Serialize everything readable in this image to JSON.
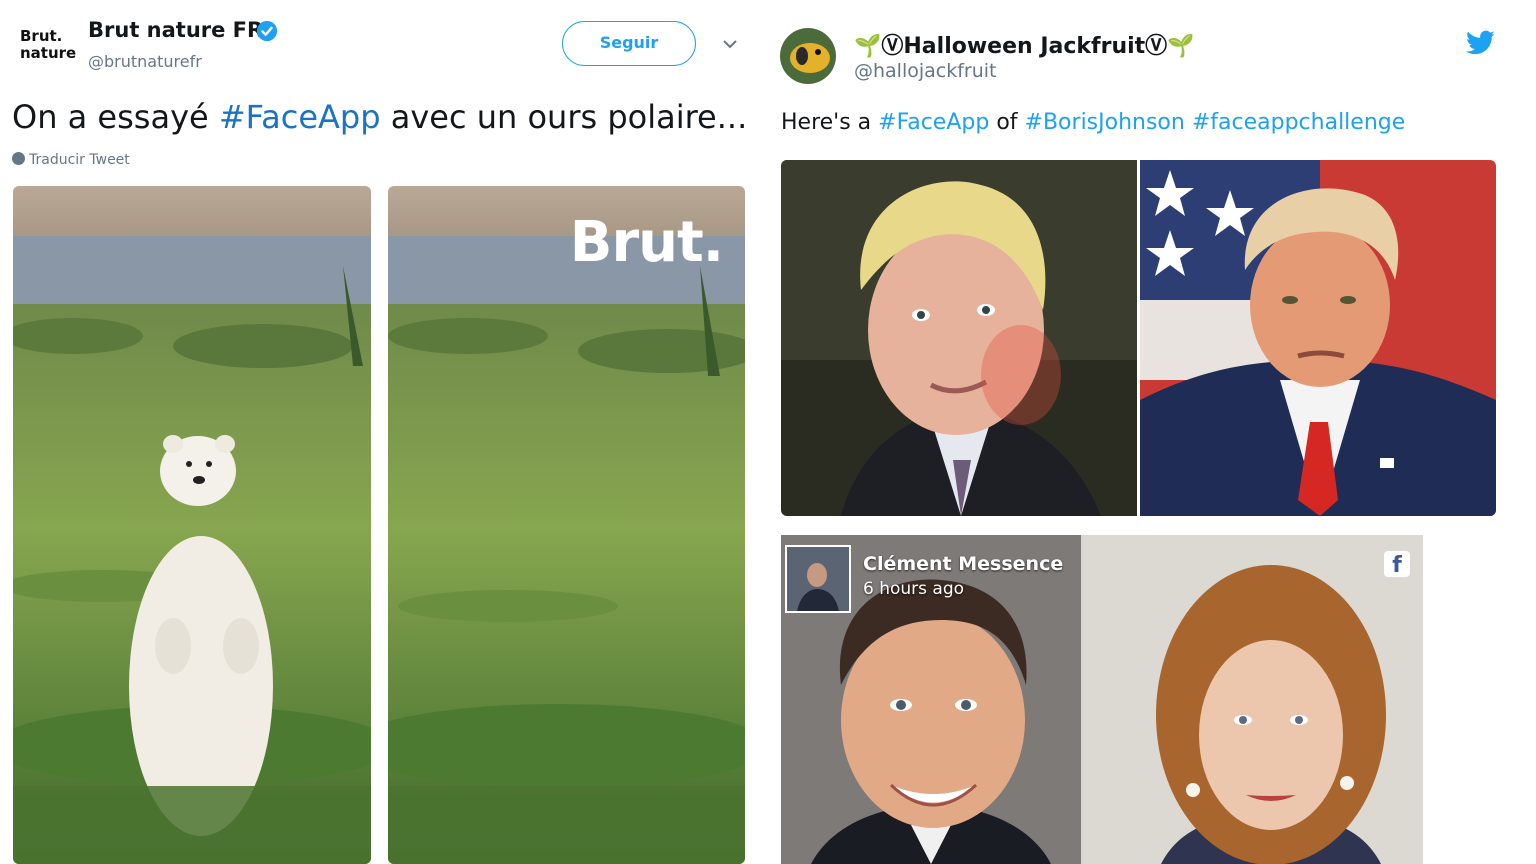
{
  "left_tweet": {
    "logo_line1": "Brut.",
    "logo_line2": "nature",
    "display_name": "Brut nature FR",
    "handle": "@brutnaturefr",
    "follow_label": "Seguir",
    "text_before": "On a essayé ",
    "hashtag": "#FaceApp",
    "text_after": " avec un ours polaire...",
    "translate_label": "Traducir Tweet",
    "watermark": "Brut."
  },
  "right_tweet": {
    "display_name": "🌱ⓋHalloween JackfruitⓋ🌱",
    "handle": "@hallojackfruit",
    "text_prefix": "Here's a ",
    "hashtag1": "#FaceApp",
    "text_of": " of ",
    "hashtag2": "#BorisJohnson",
    "hashtag3": "#faceappchallenge",
    "embedded_post": {
      "author": "Clément Messence",
      "time": "6 hours ago",
      "icon_letter": "f"
    }
  },
  "colors": {
    "twitter_blue": "#1da1f2",
    "hashtag_blue": "#1b73c4",
    "text": "#14171a",
    "muted": "#657786",
    "facebook": "#3b5998"
  },
  "icons": [
    "verified-badge-icon",
    "chevron-down-icon",
    "globe-icon",
    "twitter-bird-icon",
    "facebook-icon"
  ]
}
